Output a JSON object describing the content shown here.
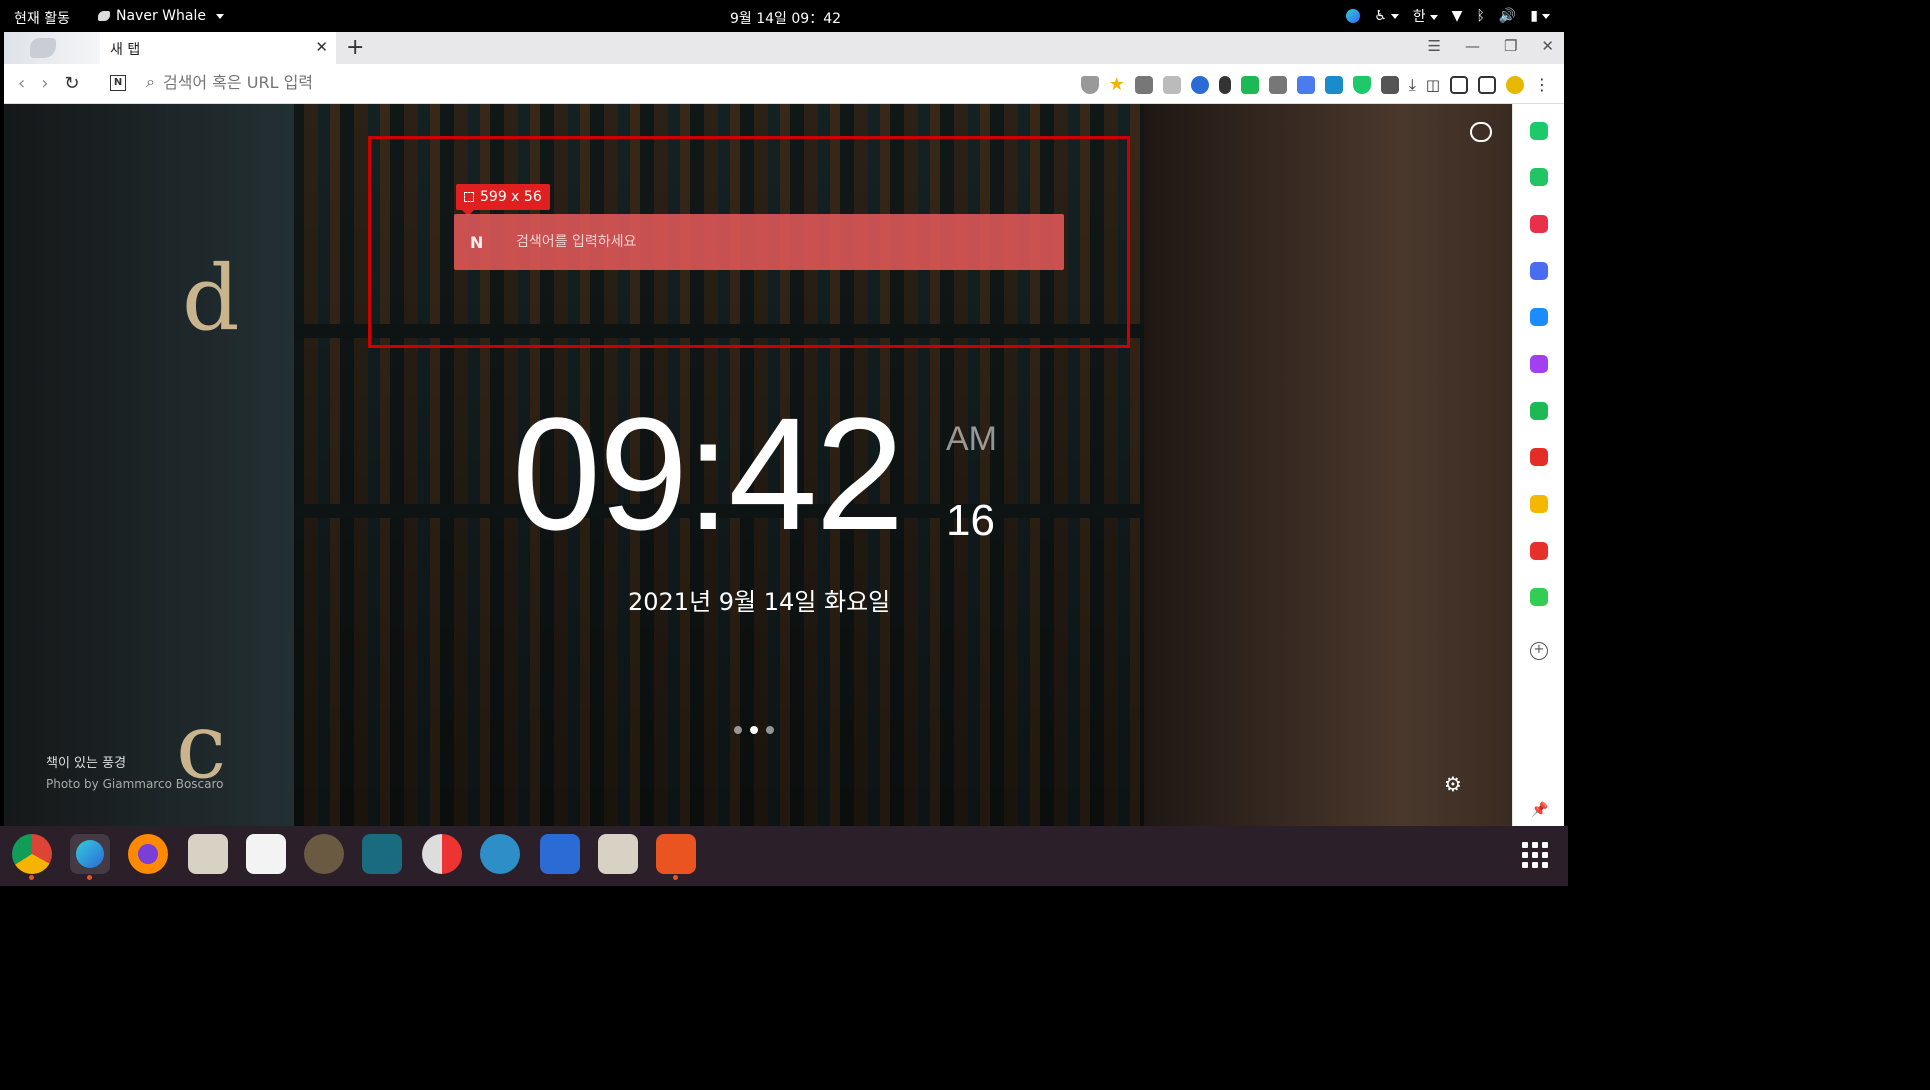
{
  "topbar": {
    "activities": "현재 활동",
    "app_name": "Naver Whale",
    "clock": "9월 14일  09：42",
    "ime": "한"
  },
  "tabs": [
    {
      "title": "새 탭"
    }
  ],
  "address_bar": {
    "placeholder": "검색어 혹은 URL 입력"
  },
  "overlay": {
    "size_label": "599 x 56"
  },
  "search": {
    "placeholder": "검색어를 입력하세요"
  },
  "clock": {
    "time": "09:42",
    "ampm": "AM",
    "seconds": "16",
    "date": "2021년 9월 14일 화요일"
  },
  "wallpaper": {
    "title": "책이 있는 풍경",
    "credit": "Photo by Giammarco Boscaro"
  },
  "sidebar_colors": [
    "#1ec96a",
    "#22c564",
    "#e8304a",
    "#4a6cf0",
    "#1a8cff",
    "#a040f0",
    "#1db954",
    "#e52d27",
    "#f5b800",
    "#e8302a",
    "#33cc55"
  ],
  "dock_apps": [
    "chrome-icon",
    "naver-whale-icon",
    "firefox-icon",
    "files-icon",
    "text-editor-icon",
    "gimp-icon",
    "panel-icon",
    "screen-recorder-icon",
    "shutter-icon",
    "libreoffice-impress-icon",
    "folder-icon",
    "software-center-icon"
  ]
}
